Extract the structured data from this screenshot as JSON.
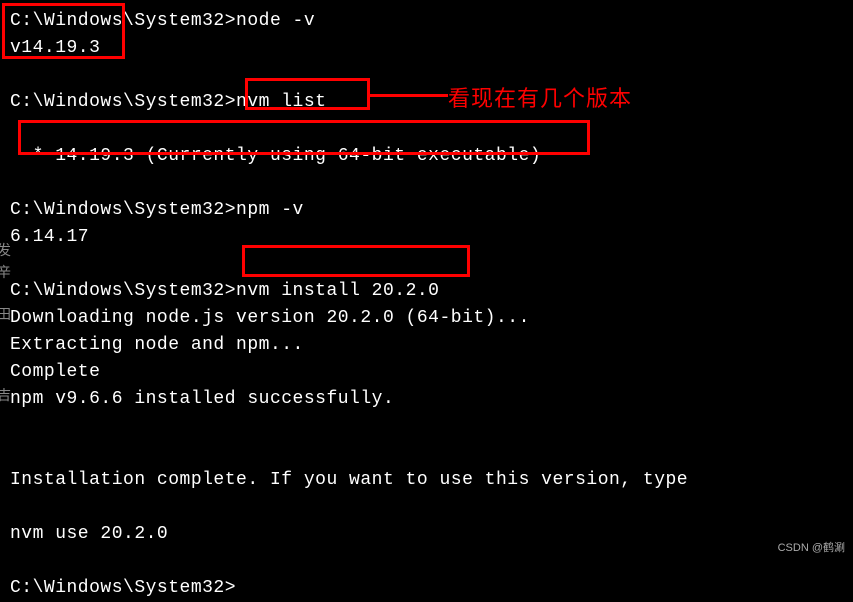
{
  "prompt": "C:\\Windows\\System32>",
  "lines": {
    "l1_cmd": "node -v",
    "l2_out": "v14.19.3",
    "l3_cmd": "nvm list",
    "l4_out": "  * 14.19.3 (Currently using 64-bit executable)",
    "l5_cmd": "npm -v",
    "l6_out": "6.14.17",
    "l7_cmd": "nvm install 20.2.0",
    "l8_out": "Downloading node.js version 20.2.0 (64-bit)...",
    "l9_out": "Extracting node and npm...",
    "l10_out": "Complete",
    "l11_out": "npm v9.6.6 installed successfully.",
    "l12_out": "Installation complete. If you want to use this version, type",
    "l13_out": "nvm use 20.2.0",
    "l14_cmd": ""
  },
  "annotation": "看现在有几个版本",
  "watermark": "CSDN @鹤涮",
  "side_chars": {
    "c1": "",
    "c2": "发",
    "c3": "辛",
    "c4": "田",
    "c5": "吉"
  }
}
